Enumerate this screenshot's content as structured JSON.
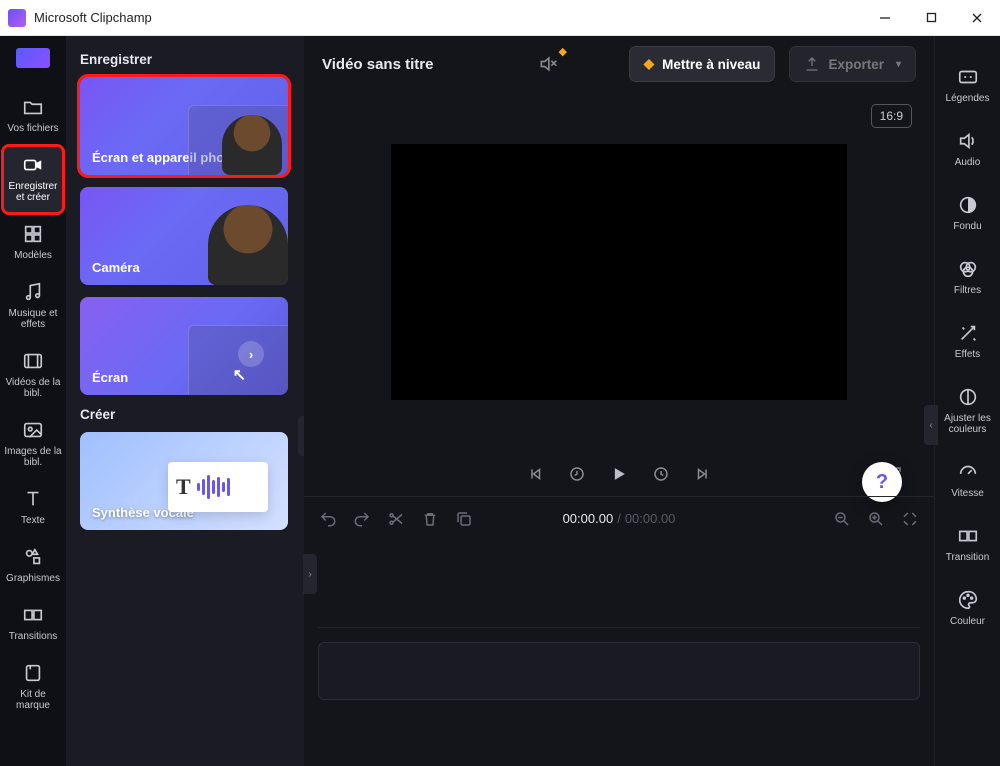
{
  "window": {
    "title": "Microsoft Clipchamp"
  },
  "left_rail": {
    "items": [
      {
        "label": "Vos fichiers"
      },
      {
        "label": "Enregistrer et créer"
      },
      {
        "label": "Modèles"
      },
      {
        "label": "Musique et effets"
      },
      {
        "label": "Vidéos de la bibl."
      },
      {
        "label": "Images de la bibl."
      },
      {
        "label": "Texte"
      },
      {
        "label": "Graphismes"
      },
      {
        "label": "Transitions"
      },
      {
        "label": "Kit de marque"
      }
    ]
  },
  "side_panel": {
    "section1_title": "Enregistrer",
    "section2_title": "Créer",
    "cards": {
      "screen_camera": "Écran et appareil photo",
      "camera": "Caméra",
      "screen": "Écran",
      "tts": "Synthèse vocale"
    }
  },
  "topbar": {
    "title": "Vidéo sans titre",
    "upgrade": "Mettre à niveau",
    "export": "Exporter"
  },
  "preview": {
    "ratio": "16:9"
  },
  "timeline": {
    "current": "00:00.00",
    "total": "00:00.00"
  },
  "right_rail": {
    "items": [
      {
        "label": "Légendes"
      },
      {
        "label": "Audio"
      },
      {
        "label": "Fondu"
      },
      {
        "label": "Filtres"
      },
      {
        "label": "Effets"
      },
      {
        "label": "Ajuster les couleurs"
      },
      {
        "label": "Vitesse"
      },
      {
        "label": "Transition"
      },
      {
        "label": "Couleur"
      }
    ]
  }
}
